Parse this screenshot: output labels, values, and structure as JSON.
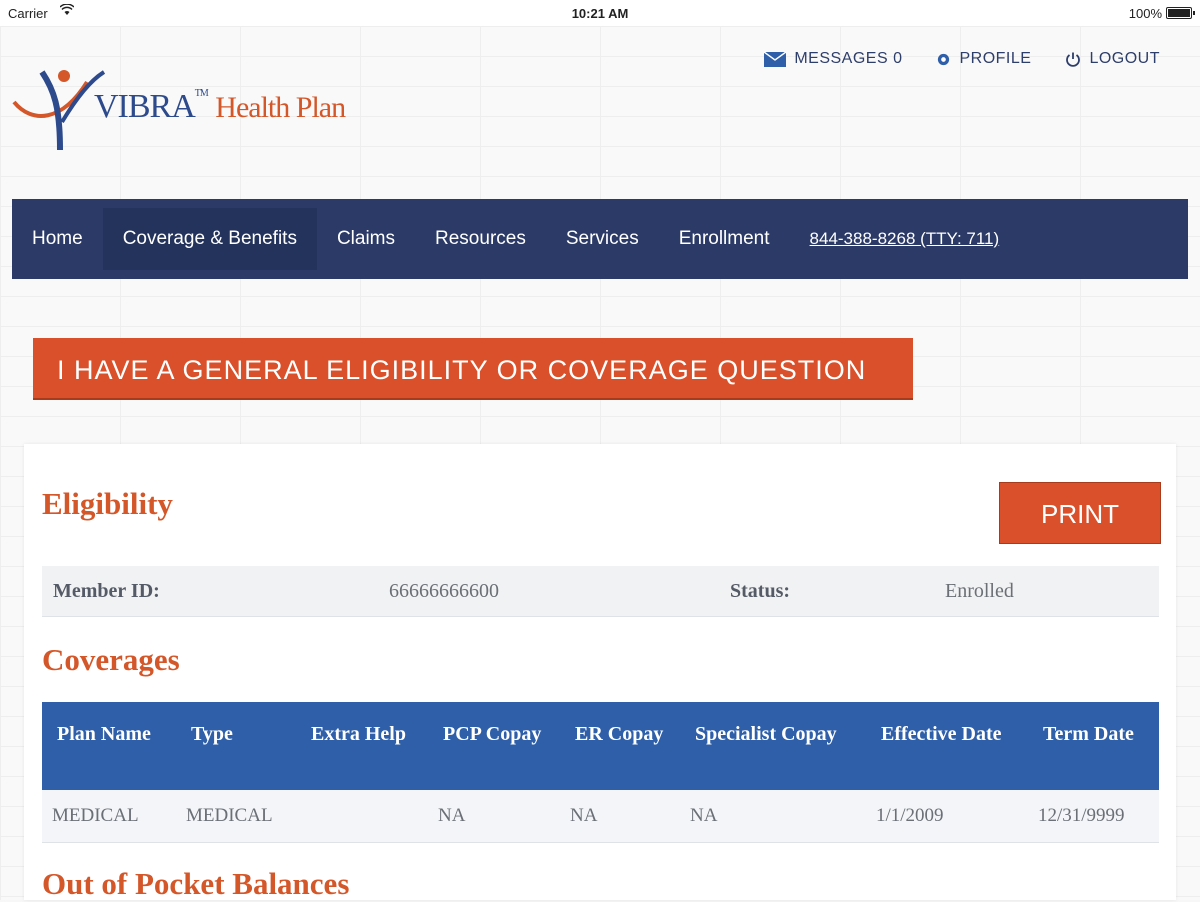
{
  "status_bar": {
    "carrier": "Carrier",
    "time": "10:21 AM",
    "battery": "100%"
  },
  "utility_nav": {
    "messages": "MESSAGES 0",
    "profile": "PROFILE",
    "logout": "LOGOUT"
  },
  "logo": {
    "brand": "VIBRA",
    "tm": "TM",
    "name": "Health Plan"
  },
  "main_nav": {
    "items": [
      "Home",
      "Coverage & Benefits",
      "Claims",
      "Resources",
      "Services",
      "Enrollment"
    ],
    "active": "Coverage & Benefits",
    "phone": "844-388-8268 (TTY: 711)"
  },
  "question_button": "I HAVE A GENERAL ELIGIBILITY OR COVERAGE QUESTION",
  "eligibility": {
    "title": "Eligibility",
    "print_label": "PRINT",
    "member_id_label": "Member ID:",
    "member_id": "66666666600",
    "status_label": "Status:",
    "status": "Enrolled"
  },
  "coverages": {
    "title": "Coverages",
    "headers": [
      "Plan Name",
      "Type",
      "Extra Help",
      "PCP Copay",
      "ER Copay",
      "Specialist Copay",
      "Effective Date",
      "Term Date"
    ],
    "rows": [
      [
        "MEDICAL",
        "MEDICAL",
        "",
        "NA",
        "NA",
        "NA",
        "1/1/2009",
        "12/31/9999"
      ]
    ]
  },
  "out_of_pocket": {
    "title": "Out of Pocket Balances"
  },
  "colors": {
    "brand_orange": "#d9502a",
    "nav_navy": "#2b3a66",
    "table_header_blue": "#2e5fa8"
  }
}
